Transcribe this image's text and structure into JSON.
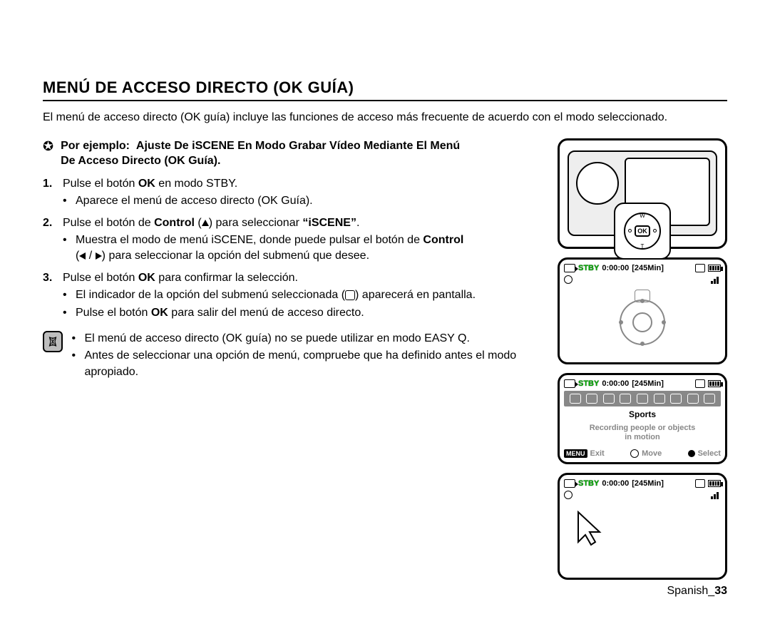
{
  "title": "MENÚ DE ACCESO DIRECTO (OK GUÍA)",
  "intro": "El menú de acceso directo (OK guía) incluye las funciones de acceso más frecuente de acuerdo con el modo seleccionado.",
  "example": {
    "label": "Por ejemplo:",
    "line1": "Ajuste De iSCENE En Modo Grabar Vídeo Mediante El Menú",
    "line2": "De Acceso Directo (OK Guía)."
  },
  "steps": {
    "s1a": "Pulse el botón ",
    "s1b": "OK",
    "s1c": " en modo STBY.",
    "s1_b1": "Aparece el menú de acceso directo (OK Guía).",
    "s2a": "Pulse el botón de ",
    "s2b": "Control",
    "s2c": " (",
    "s2d": ") para seleccionar ",
    "s2e": "“iSCENE”",
    "s2f": ".",
    "s2_b1a": "Muestra el modo de menú iSCENE, donde puede pulsar el botón de ",
    "s2_b1b": "Control",
    "s2_b1c": " (",
    "s2_b1d": " / ",
    "s2_b1e": ") para seleccionar la opción del submenú que desee.",
    "s3a": "Pulse el botón ",
    "s3b": "OK",
    "s3c": " para confirmar la selección.",
    "s3_b1a": "El indicador de la opción del submenú seleccionada (",
    "s3_b1b": ") aparecerá en pantalla.",
    "s3_b2a": "Pulse el botón ",
    "s3_b2b": "OK",
    "s3_b2c": " para salir del menú de acceso directo."
  },
  "notes": {
    "n1": "El menú de acceso directo (OK guía) no se puede utilizar en modo EASY Q.",
    "n2": "Antes de seleccionar una opción de menú, compruebe que ha definido antes el modo apropiado."
  },
  "lcd": {
    "stby": "STBY",
    "time": "0:00:00",
    "remain": "[245Min]",
    "sports": "Sports",
    "desc1": "Recording people or objects",
    "desc2": "in motion",
    "menu": "MENU",
    "exit": "Exit",
    "move": "Move",
    "select": "Select",
    "ok": "OK",
    "w": "W",
    "t": "T"
  },
  "footer": {
    "lang": "Spanish_",
    "page": "33"
  }
}
